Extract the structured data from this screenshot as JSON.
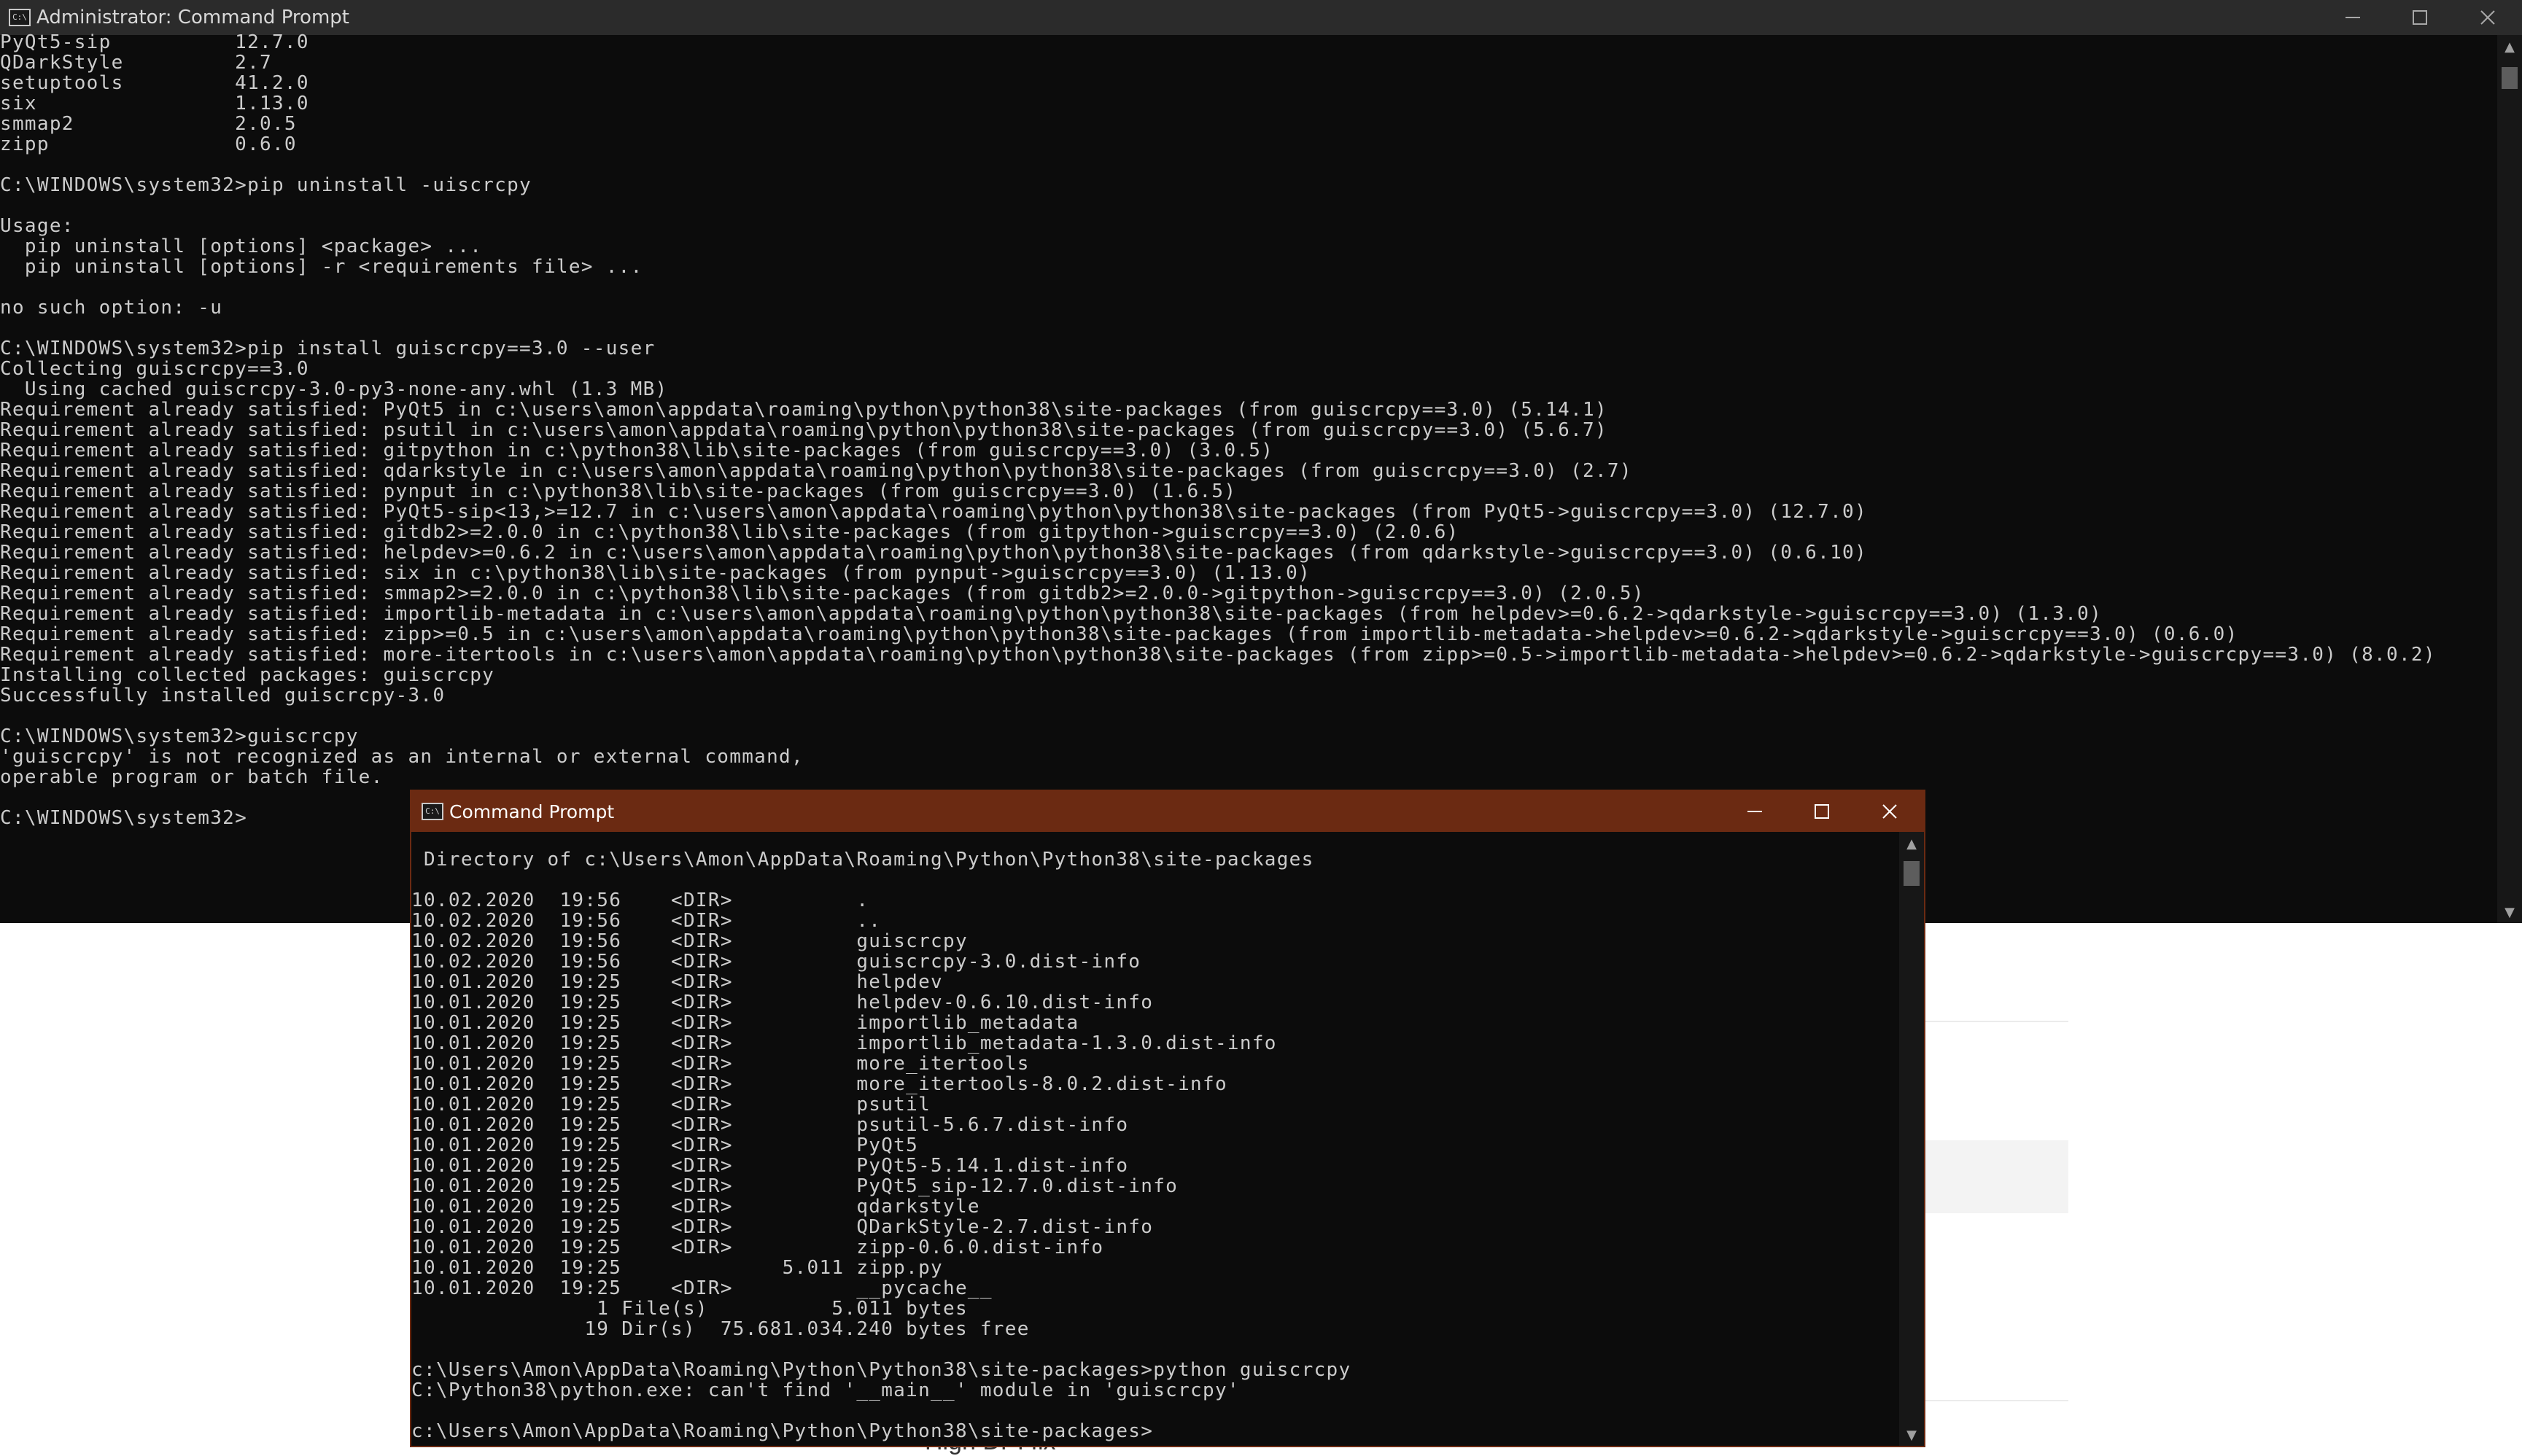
{
  "main_window": {
    "title": "Administrator: Command Prompt",
    "lines": [
      "PyQt5-sip          12.7.0",
      "QDarkStyle         2.7",
      "setuptools         41.2.0",
      "six                1.13.0",
      "smmap2             2.0.5",
      "zipp               0.6.0",
      "",
      "C:\\WINDOWS\\system32>pip uninstall -uiscrcpy",
      "",
      "Usage:",
      "  pip uninstall [options] <package> ...",
      "  pip uninstall [options] -r <requirements file> ...",
      "",
      "no such option: -u",
      "",
      "C:\\WINDOWS\\system32>pip install guiscrcpy==3.0 --user",
      "Collecting guiscrcpy==3.0",
      "  Using cached guiscrcpy-3.0-py3-none-any.whl (1.3 MB)",
      "Requirement already satisfied: PyQt5 in c:\\users\\amon\\appdata\\roaming\\python\\python38\\site-packages (from guiscrcpy==3.0) (5.14.1)",
      "Requirement already satisfied: psutil in c:\\users\\amon\\appdata\\roaming\\python\\python38\\site-packages (from guiscrcpy==3.0) (5.6.7)",
      "Requirement already satisfied: gitpython in c:\\python38\\lib\\site-packages (from guiscrcpy==3.0) (3.0.5)",
      "Requirement already satisfied: qdarkstyle in c:\\users\\amon\\appdata\\roaming\\python\\python38\\site-packages (from guiscrcpy==3.0) (2.7)",
      "Requirement already satisfied: pynput in c:\\python38\\lib\\site-packages (from guiscrcpy==3.0) (1.6.5)",
      "Requirement already satisfied: PyQt5-sip<13,>=12.7 in c:\\users\\amon\\appdata\\roaming\\python\\python38\\site-packages (from PyQt5->guiscrcpy==3.0) (12.7.0)",
      "Requirement already satisfied: gitdb2>=2.0.0 in c:\\python38\\lib\\site-packages (from gitpython->guiscrcpy==3.0) (2.0.6)",
      "Requirement already satisfied: helpdev>=0.6.2 in c:\\users\\amon\\appdata\\roaming\\python\\python38\\site-packages (from qdarkstyle->guiscrcpy==3.0) (0.6.10)",
      "Requirement already satisfied: six in c:\\python38\\lib\\site-packages (from pynput->guiscrcpy==3.0) (1.13.0)",
      "Requirement already satisfied: smmap2>=2.0.0 in c:\\python38\\lib\\site-packages (from gitdb2>=2.0.0->gitpython->guiscrcpy==3.0) (2.0.5)",
      "Requirement already satisfied: importlib-metadata in c:\\users\\amon\\appdata\\roaming\\python\\python38\\site-packages (from helpdev>=0.6.2->qdarkstyle->guiscrcpy==3.0) (1.3.0)",
      "Requirement already satisfied: zipp>=0.5 in c:\\users\\amon\\appdata\\roaming\\python\\python38\\site-packages (from importlib-metadata->helpdev>=0.6.2->qdarkstyle->guiscrcpy==3.0) (0.6.0)",
      "Requirement already satisfied: more-itertools in c:\\users\\amon\\appdata\\roaming\\python\\python38\\site-packages (from zipp>=0.5->importlib-metadata->helpdev>=0.6.2->qdarkstyle->guiscrcpy==3.0) (8.0.2)",
      "Installing collected packages: guiscrcpy",
      "Successfully installed guiscrcpy-3.0",
      "",
      "C:\\WINDOWS\\system32>guiscrcpy",
      "'guiscrcpy' is not recognized as an internal or external command,",
      "operable program or batch file.",
      "",
      "C:\\WINDOWS\\system32>"
    ]
  },
  "sub_window": {
    "title": "Command Prompt",
    "lines": [
      " Directory of c:\\Users\\Amon\\AppData\\Roaming\\Python\\Python38\\site-packages",
      "",
      "10.02.2020  19:56    <DIR>          .",
      "10.02.2020  19:56    <DIR>          ..",
      "10.02.2020  19:56    <DIR>          guiscrcpy",
      "10.02.2020  19:56    <DIR>          guiscrcpy-3.0.dist-info",
      "10.01.2020  19:25    <DIR>          helpdev",
      "10.01.2020  19:25    <DIR>          helpdev-0.6.10.dist-info",
      "10.01.2020  19:25    <DIR>          importlib_metadata",
      "10.01.2020  19:25    <DIR>          importlib_metadata-1.3.0.dist-info",
      "10.01.2020  19:25    <DIR>          more_itertools",
      "10.01.2020  19:25    <DIR>          more_itertools-8.0.2.dist-info",
      "10.01.2020  19:25    <DIR>          psutil",
      "10.01.2020  19:25    <DIR>          psutil-5.6.7.dist-info",
      "10.01.2020  19:25    <DIR>          PyQt5",
      "10.01.2020  19:25    <DIR>          PyQt5-5.14.1.dist-info",
      "10.01.2020  19:25    <DIR>          PyQt5_sip-12.7.0.dist-info",
      "10.01.2020  19:25    <DIR>          qdarkstyle",
      "10.01.2020  19:25    <DIR>          QDarkStyle-2.7.dist-info",
      "10.01.2020  19:25    <DIR>          zipp-0.6.0.dist-info",
      "10.01.2020  19:25             5.011 zipp.py",
      "10.01.2020  19:25    <DIR>          __pycache__",
      "               1 File(s)          5.011 bytes",
      "              19 Dir(s)  75.681.034.240 bytes free",
      "",
      "c:\\Users\\Amon\\AppData\\Roaming\\Python\\Python38\\site-packages>python guiscrcpy",
      "C:\\Python38\\python.exe: can't find '__main__' module in 'guiscrcpy'",
      "",
      "c:\\Users\\Amon\\AppData\\Roaming\\Python\\Python38\\site-packages>"
    ]
  },
  "background_page": {
    "visible_text": "High DPI fix"
  },
  "icons": {
    "window_icon": "C:\\",
    "scroll_up": "▲",
    "scroll_down": "▼"
  },
  "colors": {
    "console_bg": "#0c0c0c",
    "console_text": "#cccccc",
    "main_titlebar": "#2b2b2b",
    "active_titlebar": "#6b2a12"
  }
}
